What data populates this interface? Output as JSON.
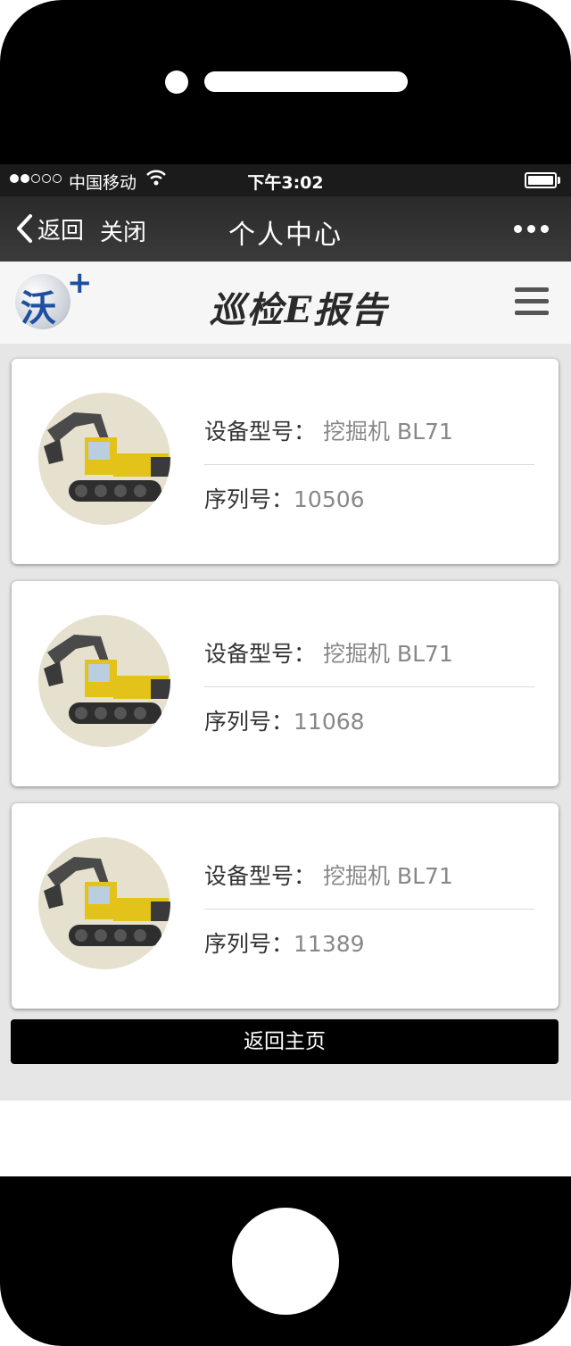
{
  "status_bar": {
    "carrier": "中国移动",
    "time": "下午3:02"
  },
  "nav_bar": {
    "back_label": "返回",
    "close_label": "关闭",
    "title": "个人中心"
  },
  "header": {
    "logo_text": "沃",
    "logo_plus": "+",
    "brand_title": "巡检E报告"
  },
  "cards": [
    {
      "model_label": "设备型号：",
      "model_value": "挖掘机 BL71",
      "serial_label": "序列号：",
      "serial_value": "10506"
    },
    {
      "model_label": "设备型号：",
      "model_value": "挖掘机 BL71",
      "serial_label": "序列号：",
      "serial_value": "11068"
    },
    {
      "model_label": "设备型号：",
      "model_value": "挖掘机 BL71",
      "serial_label": "序列号：",
      "serial_value": "11389"
    }
  ],
  "home_button": "返回主页",
  "colors": {
    "nav_bg": "#333333",
    "brand_blue": "#1f4fa0",
    "excavator_yellow": "#e3c21a",
    "page_bg": "#e6e6e6"
  }
}
